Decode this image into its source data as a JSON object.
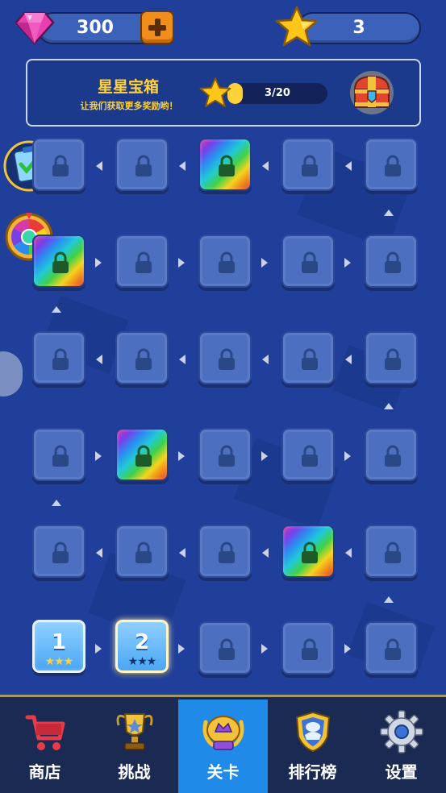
{
  "topbar": {
    "gems": "300",
    "stars": "3"
  },
  "star_chest": {
    "title": "星星宝箱",
    "subtitle": "让我们获取更多奖励哟！",
    "progress_text": "3/20",
    "progress_fraction": 0.15
  },
  "levels": {
    "level_1": {
      "number": "1",
      "stars": "★★★"
    },
    "level_2": {
      "number": "2",
      "stars": "★★★"
    }
  },
  "nav": {
    "items": [
      {
        "label": "商店",
        "icon": "shopping-cart-icon"
      },
      {
        "label": "挑战",
        "icon": "trophy-icon"
      },
      {
        "label": "关卡",
        "icon": "level-badge-icon",
        "active": true
      },
      {
        "label": "排行榜",
        "icon": "leaderboard-shield-icon"
      },
      {
        "label": "设置",
        "icon": "gear-icon"
      }
    ]
  },
  "colors": {
    "background": "#1f3f9a",
    "tile_locked": "#4c6fc0",
    "accent_gold": "#ffd23a",
    "nav_active": "#1f8ae8",
    "nav_background": "#1a2a52"
  }
}
